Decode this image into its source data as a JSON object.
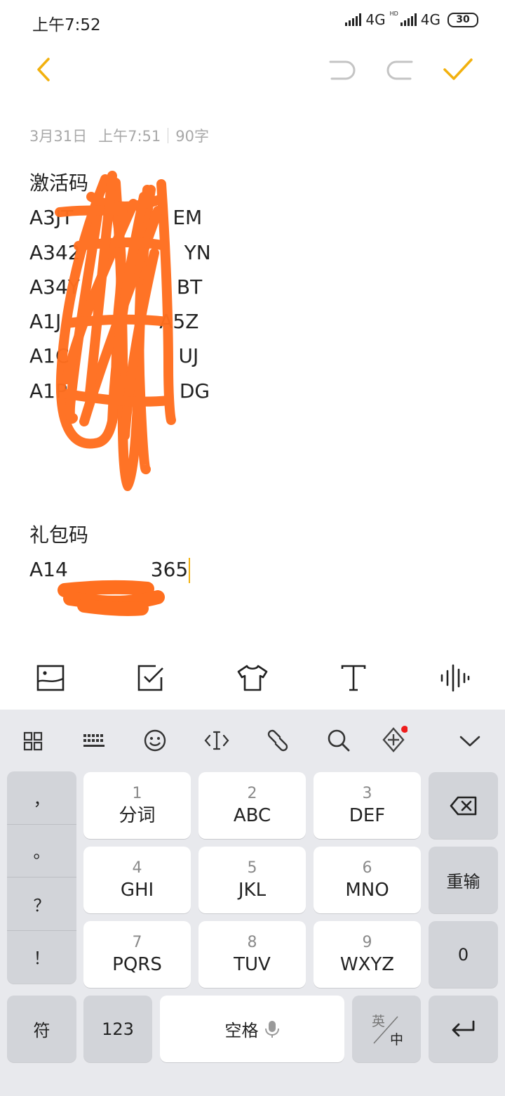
{
  "status_bar": {
    "time": "上午7:52",
    "network1": "4G",
    "network2": "4G",
    "hd": "HD",
    "battery": "30"
  },
  "toolbar": {
    "back_icon": "chevron-left-icon",
    "undo_icon": "undo-icon",
    "redo_icon": "redo-icon",
    "done_icon": "check-icon",
    "accent": "#f2b10e"
  },
  "note": {
    "date": "3月31日",
    "time": "上午7:51",
    "count": "90字",
    "lines": [
      "激活码",
      "A3JT",
      "EM",
      "A342",
      "YN",
      "A34Y",
      "BT",
      "A1J",
      "A5Z",
      "A1C",
      "UJ",
      "A1P",
      "DG",
      "礼包码",
      "A14",
      "365"
    ],
    "scribble_color": "#ff6f1f"
  },
  "format_bar": {
    "icons": [
      "image-icon",
      "checklist-icon",
      "shirt-icon",
      "text-format-icon",
      "audio-icon"
    ]
  },
  "keyboard": {
    "tools": [
      "grid-icon",
      "keyboard-icon",
      "emoji-icon",
      "cursor-icon",
      "link-icon",
      "search-icon",
      "plugin-icon",
      "collapse-icon"
    ],
    "punctuation": [
      "，",
      "。",
      "？",
      "！"
    ],
    "keys": [
      {
        "num": "1",
        "label": "分词"
      },
      {
        "num": "2",
        "label": "ABC"
      },
      {
        "num": "3",
        "label": "DEF"
      },
      {
        "num": "4",
        "label": "GHI"
      },
      {
        "num": "5",
        "label": "JKL"
      },
      {
        "num": "6",
        "label": "MNO"
      },
      {
        "num": "7",
        "label": "PQRS"
      },
      {
        "num": "8",
        "label": "TUV"
      },
      {
        "num": "9",
        "label": "WXYZ"
      }
    ],
    "retype": "重输",
    "zero": "0",
    "symbol": "符",
    "num_switch": "123",
    "space": "空格",
    "lang_top": "英",
    "lang_bottom": "中"
  }
}
